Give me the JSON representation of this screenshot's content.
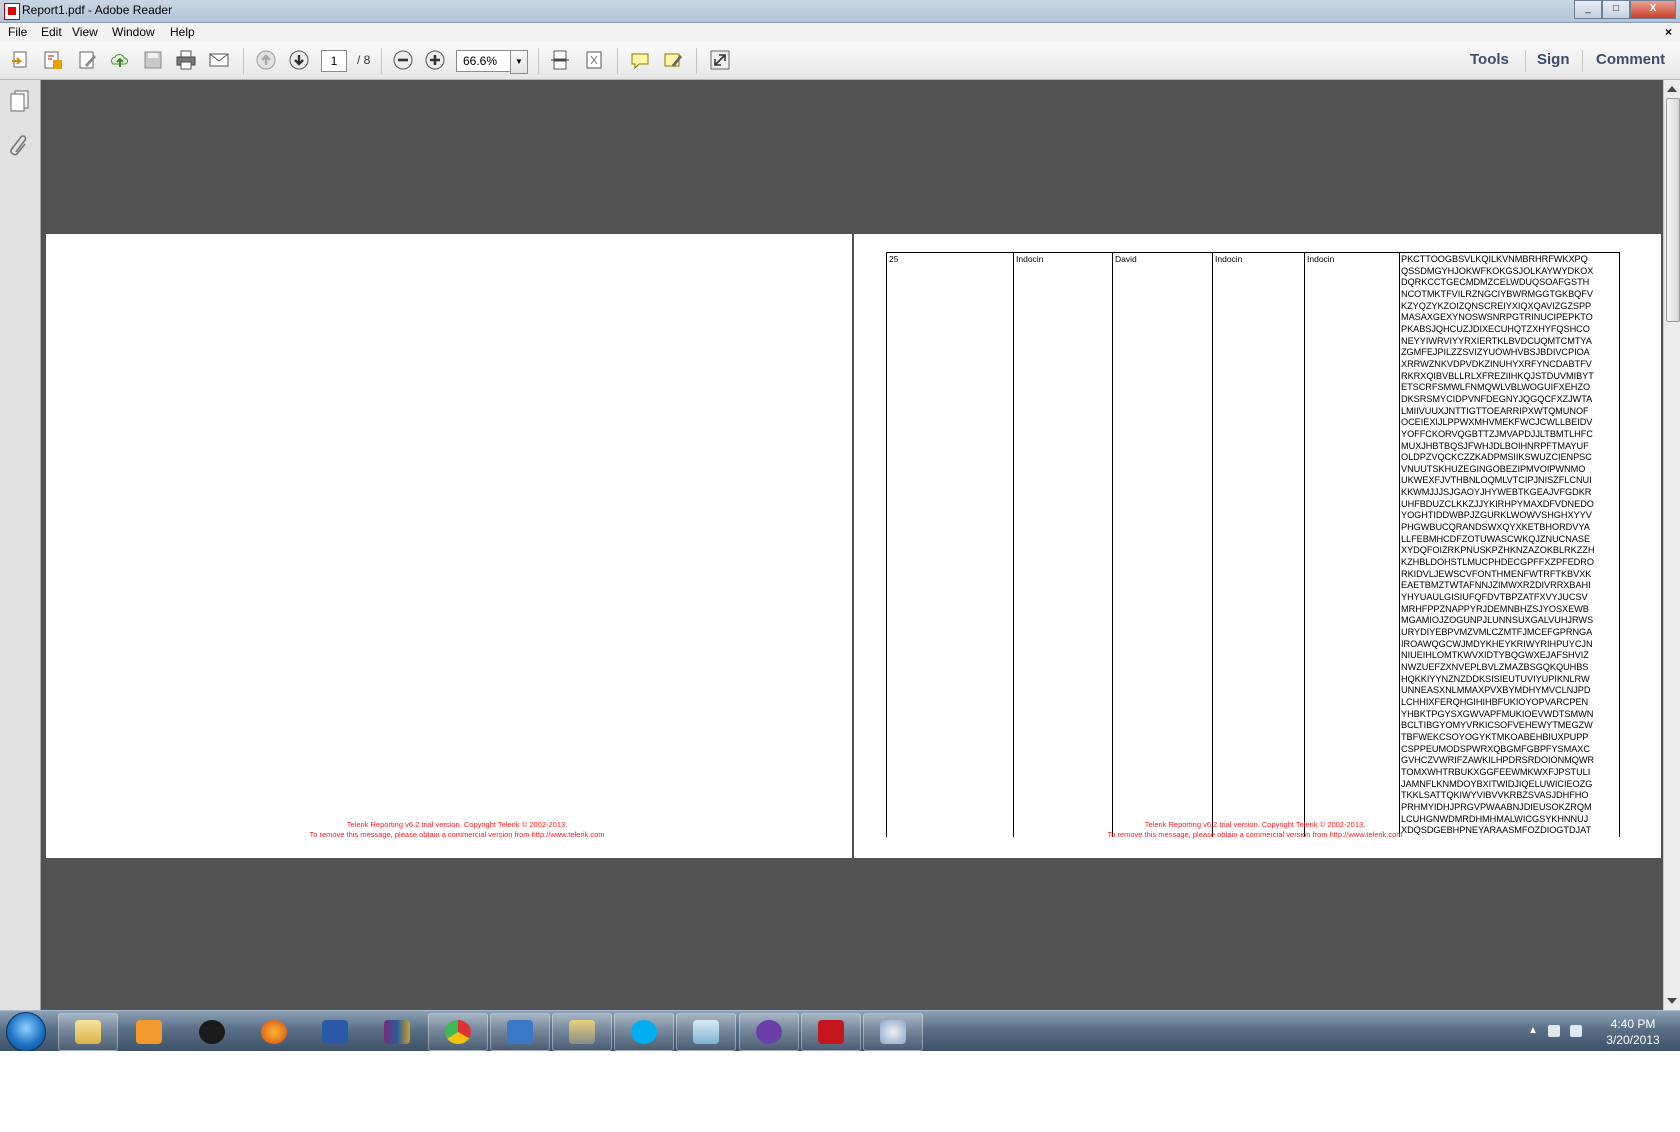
{
  "window": {
    "title": "Report1.pdf - Adobe Reader",
    "min_label": "_",
    "max_label": "□",
    "close_label": "X"
  },
  "menu": {
    "file": "File",
    "edit": "Edit",
    "view": "View",
    "window": "Window",
    "help": "Help",
    "doc_close": "×"
  },
  "toolbar": {
    "current_page": "1",
    "total_pages": "/ 8",
    "zoom": "66.6%",
    "tools_label": "Tools",
    "sign_label": "Sign",
    "comment_label": "Comment"
  },
  "watermark": {
    "line1": "Telerik Reporting v6.2 trial version. Copyright Telerik © 2002-2013.",
    "line2": "To remove this message, please obtain a commercial version from http://www.telerik.com"
  },
  "report_row": {
    "col1": "25",
    "col2": "Indocin",
    "col3": "David",
    "col4": "Indocin",
    "col5": "Indocin",
    "long_text": "PKCTTOOGBSVLKQILKVNMBRHRFWKXPQ\nQSSDMGYHJOKWFKOKGSJOLKAYWYDKOX\nDQRKCCTGECMDMZCELWDUQSOAFGSTH\nNCOTMKTFVILRZNGCIYBWRMGGTGKBQFV\nKZYQZYKZOIZQNSCREIYXIQXQAVIZGZSPP\nMASAXGEXYNOSWSNRPGTRINUCIPEPKTO\nPKABSJQHCUZJDIXECUHQTZXHYFQSHCO\nNEYYIWRVIYYRXIERTKLBVDCUQMTCMTYA\nZGMFEJPILZZSVIZYUOWHVBSJBDIVCPIOA\nXRRWZNKVDPVDKZINUHYXRFYNCDABTFV\nRKRXQIBVBLLRLXFREZIIHKQJSTDUVMIBYT\nETSCRFSMWLFNMQWLVBLWOGUIFXEHZO\nDKSRSMYCIDPVNFDEGNYJQGQCFXZJWTA\nLMIIVUUXJNTTIGTTOEARRIPXWTQMUNOF\nOCEIEXIJLPPWXMHVMEKFWCJCWLLBEIDV\nYOFFCKORVQGBTTZJMVAPDJJLTBMTLHFC\nMUXJHBTBQSJFWHJDLBOIHNRPFTMAYUF\nOLDPZVQCKCZZKADPMSIIKSWUZCIENPSC\nVNUUTSKHUZEGINGOBEZIPMVOIPWNMO\nUKWEXFJVTHBNLOQMLVTCIPJNISZFLCNUI\nKKWMJJJSJGAOYJHYWEBTKGEAJVFGDKR\nUHFBDUZCLKKZJJYKIRHPYMAXDFVDNEDO\nYOGHTIDDWBPJZGURKLWOWVSHGHXYYV\nPHGWBUCQRANDSWXQYXKETBHORDVYA\nLLFEBMHCDFZOTUWASCWKQJZNUCNASE\nXYDQFOIZRKPNUSKPZHKNZAZOKBLRKZZH\nKZHBLDOHSTLMUCPHDECGPFFXZPFEDRO\nRKIDVLJEWSCVFONTHMENFWTRFTKBVXK\nEAETBMZTWTAFNNJZIMWXRZDIVRRXBAHI\nYHYUAULGISIUFQFDVTBPZATFXVYJUCSV\nMRHFPPZNAPPYRJDEMNBHZSJYOSXEWB\nMGAMIOJZOGUNPJLUNNSUXGALVUHJRWS\nURYDIYEBPVMZVMLCZMTFJMCEFGPRNGA\nIROAWQGCWJMDYKHEYKRIWYRIHPUYCJN\nNIUEIHLOMTKWVXIDTYBQGWXEJAFSHVIZ\nNWZUEFZXNVEPLBVLZMAZBSGQKQUHBS\nHQKKIYYNZNZDDKSISIEUTUVIYUPIKNLRW\nUNNEASXNLMMAXPVXBYMDHYMVCLNJPD\nLCHHIXFERQHGIHIHBFUKIOYOPVARCPEN\nYHBKTPGYSXGWVAPFMUKIOEVWDTSMWN\nBCLTIBGYOMYVRKICSOFVEHEWYTMEGZW\nTBFWEKCSOYOGYKTMKOABEHBIUXPUPP\nCSPPEUMODSPWRXQBGMFGBPFYSMAXC\nGVHCZVWRIFZAWKILHPDRSRDOIONMQWR\nTOMXWHTRBUKXGGFEEWMKWXFJPSTULI\nJAMNFLKNMDOYBXITWIDJIQELUWICIEOZG\nTKKLSATTQKIWYVIBVVKRBZSVASJDHFHO\nPRHMYIDHJPRGVPWAABNJDIEUSOKZRQM\nLCUHGNWDMRDHMHMALWICGSYKHNNUJ\nXDQSDGEBHPNEYARAASMFOZDIOGTDJAT"
  },
  "taskbar": {
    "clock_time": "4:40 PM",
    "clock_date": "3/20/2013"
  }
}
